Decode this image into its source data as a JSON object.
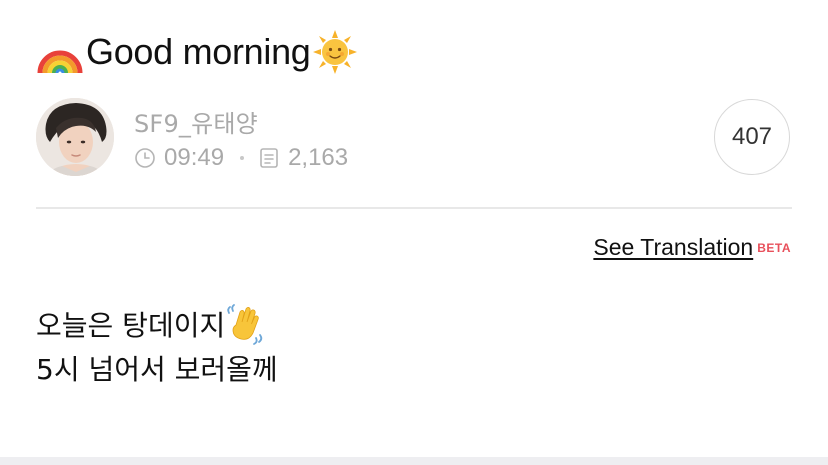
{
  "post": {
    "title": "Good morning",
    "title_lead_emoji": "rainbow-emoji",
    "title_trail_emoji": "sun-with-face-emoji",
    "author": {
      "name": "SF9_유태양",
      "avatar": "profile-photo"
    },
    "meta": {
      "time": "09:49",
      "count": "2,163",
      "time_icon": "clock-icon",
      "count_icon": "document-icon"
    },
    "likes": "407",
    "body_lines": [
      "오늘은 탕데이지",
      "5시 넘어서 보러올께"
    ],
    "body_emoji": "waving-hand-emoji"
  },
  "translation": {
    "label": "See Translation",
    "badge": "BETA",
    "badge_color": "#e8505b"
  },
  "colors": {
    "muted_text": "#a9a9a9",
    "divider": "#e8e8e8",
    "bottom_bar": "#eeeef1"
  }
}
